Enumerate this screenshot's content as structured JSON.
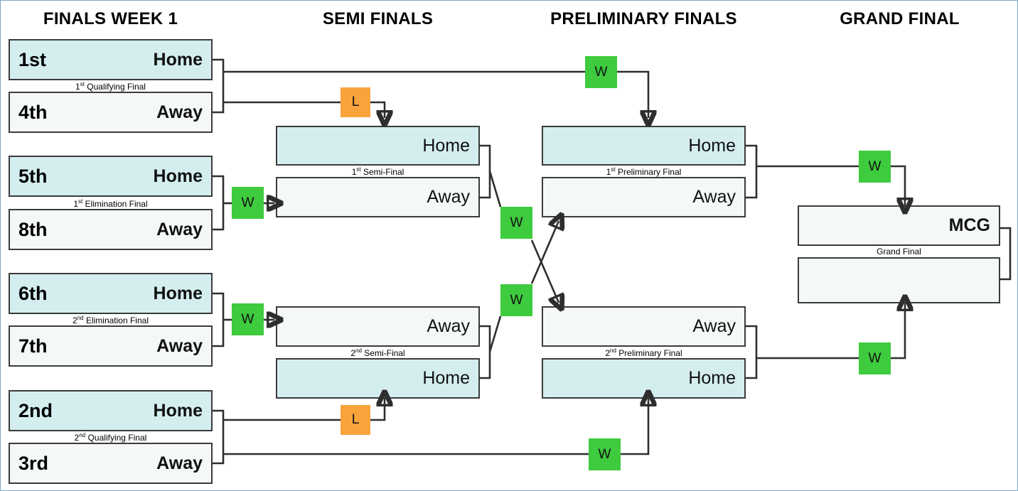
{
  "headers": [
    {
      "label": "FINALS WEEK 1"
    },
    {
      "label": "SEMI FINALS"
    },
    {
      "label": "PRELIMINARY FINALS"
    },
    {
      "label": "GRAND FINAL"
    }
  ],
  "week1": {
    "matches": [
      {
        "label_prefix": "1",
        "label_sup": "st",
        "label_suffix": " Qualifying Final",
        "home": {
          "seed": "1st",
          "side": "Home"
        },
        "away": {
          "seed": "4th",
          "side": "Away"
        }
      },
      {
        "label_prefix": "1",
        "label_sup": "st",
        "label_suffix": " Elimination  Final",
        "home": {
          "seed": "5th",
          "side": "Home"
        },
        "away": {
          "seed": "8th",
          "side": "Away"
        }
      },
      {
        "label_prefix": "2",
        "label_sup": "nd",
        "label_suffix": "  Elimination Final",
        "home": {
          "seed": "6th",
          "side": "Home"
        },
        "away": {
          "seed": "7th",
          "side": "Away"
        }
      },
      {
        "label_prefix": "2",
        "label_sup": "nd",
        "label_suffix": "  Qualifying Final",
        "home": {
          "seed": "2nd",
          "side": "Home"
        },
        "away": {
          "seed": "3rd",
          "side": "Away"
        }
      }
    ]
  },
  "semifinals": {
    "matches": [
      {
        "label_prefix": "1",
        "label_sup": "st",
        "label_suffix": " Semi-Final",
        "top": {
          "side": "Home"
        },
        "bottom": {
          "side": "Away"
        }
      },
      {
        "label_prefix": "2",
        "label_sup": "nd",
        "label_suffix": " Semi-Final",
        "top": {
          "side": "Away"
        },
        "bottom": {
          "side": "Home"
        }
      }
    ]
  },
  "preliminaryfinals": {
    "matches": [
      {
        "label_prefix": "1",
        "label_sup": "st",
        "label_suffix": " Preliminary Final",
        "top": {
          "side": "Home"
        },
        "bottom": {
          "side": "Away"
        }
      },
      {
        "label_prefix": "2",
        "label_sup": "nd",
        "label_suffix": " Preliminary Final",
        "top": {
          "side": "Away"
        },
        "bottom": {
          "side": "Home"
        }
      }
    ]
  },
  "grandfinal": {
    "label": "Grand Final",
    "top": {
      "venue": "MCG"
    },
    "bottom": {
      "venue": ""
    }
  },
  "badges": {
    "winner": "W",
    "loser": "L"
  },
  "colors": {
    "winner_bg": "#3ecb3e",
    "loser_bg": "#f9a33c",
    "home_fill": "#d4eef0",
    "away_fill": "#f4f8f8",
    "border": "#3b3b3b",
    "frame": "#7aa7c7"
  }
}
